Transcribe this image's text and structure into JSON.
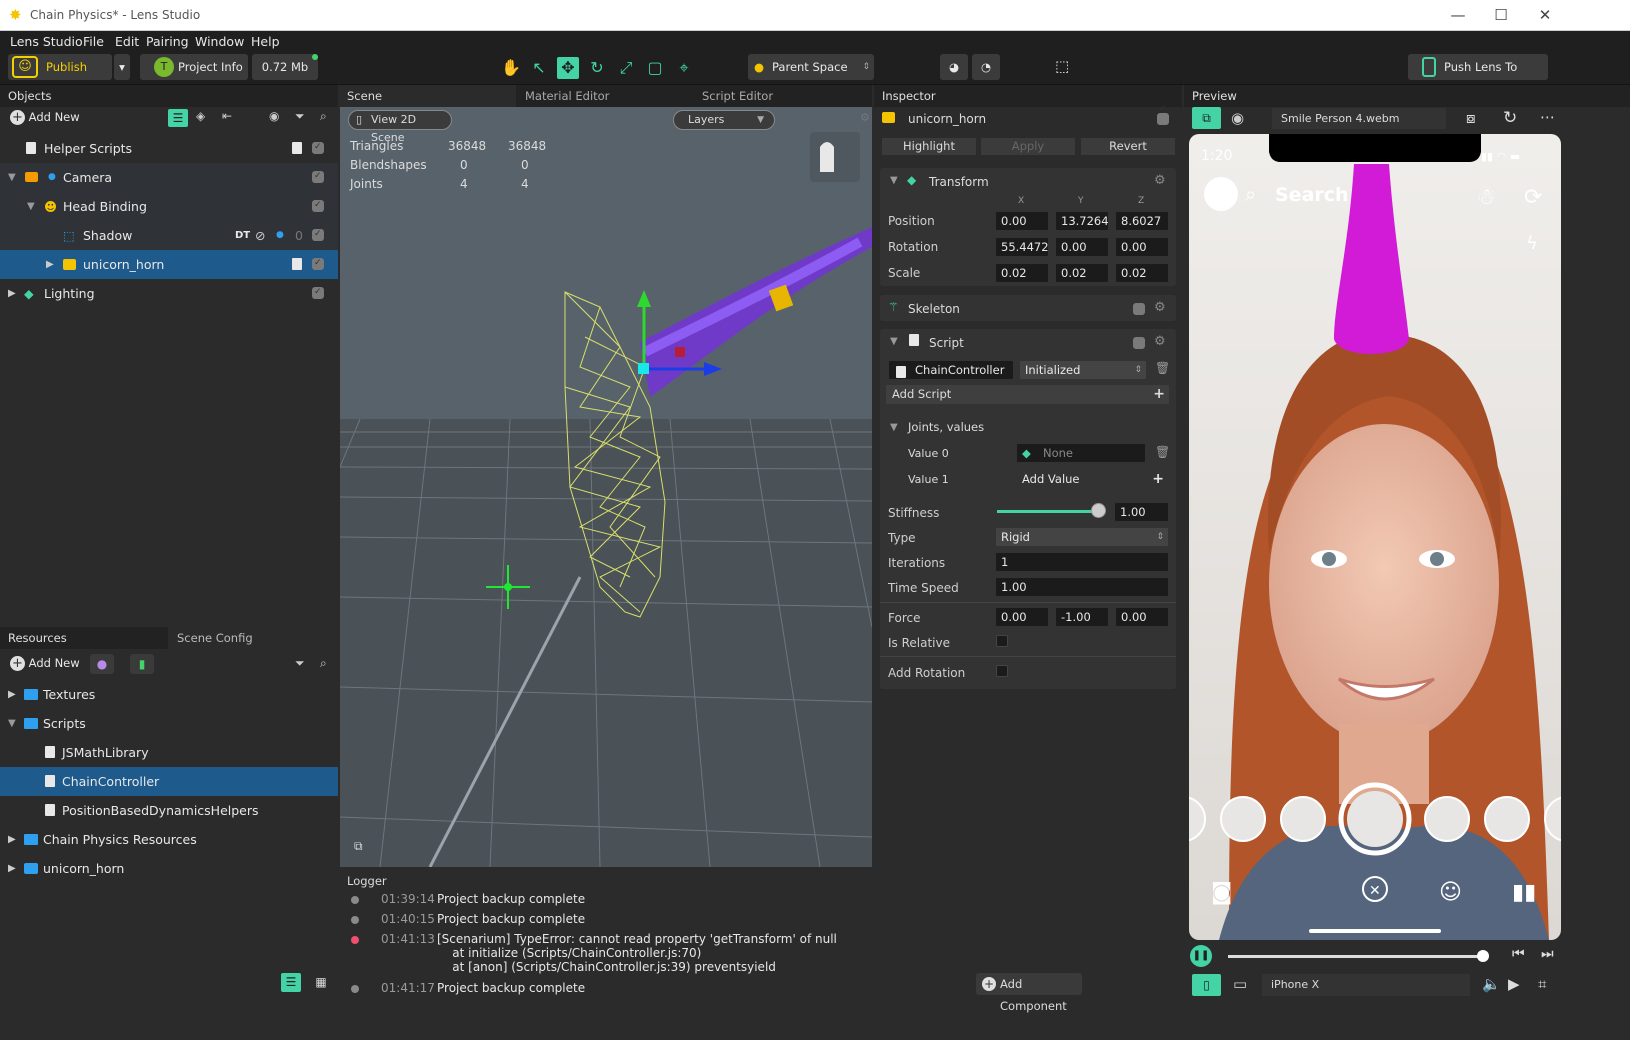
{
  "window": {
    "title": "Chain Physics* - Lens Studio",
    "minimize": "—",
    "maximize": "☐",
    "close": "✕"
  },
  "menu": [
    "Lens Studio",
    "File",
    "Edit",
    "Pairing",
    "Window",
    "Help"
  ],
  "toolbar": {
    "publish": "Publish Lens",
    "project_info": "Project Info",
    "size": "0.72 Mb",
    "space": "Parent Space",
    "push": "Push Lens To Device"
  },
  "objects": {
    "title": "Objects",
    "add_new": "Add New",
    "items": [
      {
        "label": "Helper Scripts"
      },
      {
        "label": "Camera"
      },
      {
        "label": "Head Binding"
      },
      {
        "label": "Shadow",
        "badge": "DT",
        "count": "0"
      },
      {
        "label": "unicorn_horn"
      },
      {
        "label": "Lighting"
      }
    ]
  },
  "resources": {
    "tab1": "Resources",
    "tab2": "Scene Config",
    "add_new": "Add New",
    "items": [
      {
        "label": "Textures"
      },
      {
        "label": "Scripts"
      },
      {
        "label": "JSMathLibrary"
      },
      {
        "label": "ChainController"
      },
      {
        "label": "PositionBasedDynamicsHelpers"
      },
      {
        "label": "Chain Physics Resources"
      },
      {
        "label": "unicorn_horn"
      }
    ]
  },
  "scene": {
    "tabs": [
      "Scene",
      "Material Editor",
      "Script Editor"
    ],
    "view2d": "View 2D Scene",
    "layers": "Layers",
    "stats": [
      {
        "k": "Triangles",
        "a": "36848",
        "b": "36848"
      },
      {
        "k": "Blendshapes",
        "a": "0",
        "b": "0"
      },
      {
        "k": "Joints",
        "a": "4",
        "b": "4"
      }
    ]
  },
  "logger": {
    "title": "Logger",
    "lines": [
      {
        "time": "01:39:14",
        "msg": "Project backup complete",
        "error": false
      },
      {
        "time": "01:40:15",
        "msg": "Project backup complete",
        "error": false
      },
      {
        "time": "01:41:13",
        "msg": "[Scenarium] TypeError: cannot read property 'getTransform' of null\n    at initialize (Scripts/ChainController.js:70)\n    at [anon] (Scripts/ChainController.js:39) preventsyield",
        "error": true
      },
      {
        "time": "01:41:17",
        "msg": "Project backup complete",
        "error": false
      }
    ]
  },
  "inspector": {
    "title": "Inspector",
    "object": "unicorn_horn",
    "highlight": "Highlight",
    "apply": "Apply",
    "revert": "Revert",
    "transform": {
      "title": "Transform",
      "x": "X",
      "y": "Y",
      "z": "Z",
      "position": {
        "label": "Position",
        "v": [
          "0.00",
          "13.7264",
          "8.6027"
        ]
      },
      "rotation": {
        "label": "Rotation",
        "v": [
          "55.4472",
          "0.00",
          "0.00"
        ]
      },
      "scale": {
        "label": "Scale",
        "v": [
          "0.02",
          "0.02",
          "0.02"
        ]
      }
    },
    "skeleton": "Skeleton",
    "script": "Script",
    "script_name": "ChainController",
    "script_state": "Initialized",
    "add_script": "Add Script",
    "joints": "Joints, values",
    "value0": "Value 0",
    "value0_val": "None",
    "value1": "Value 1",
    "add_value": "Add Value",
    "stiffness": {
      "label": "Stiffness",
      "value": "1.00",
      "fraction": 1.0
    },
    "type": {
      "label": "Type",
      "value": "Rigid"
    },
    "iterations": {
      "label": "Iterations",
      "value": "1"
    },
    "time_speed": {
      "label": "Time Speed",
      "value": "1.00"
    },
    "force": {
      "label": "Force",
      "v": [
        "0.00",
        "-1.00",
        "0.00"
      ]
    },
    "is_relative": "Is Relative",
    "add_rotation": "Add Rotation",
    "add_component": "Add Component"
  },
  "preview": {
    "title": "Preview",
    "media": "Smile Person 4.webm",
    "time": "1:20",
    "search": "Search",
    "device": "iPhone X"
  }
}
